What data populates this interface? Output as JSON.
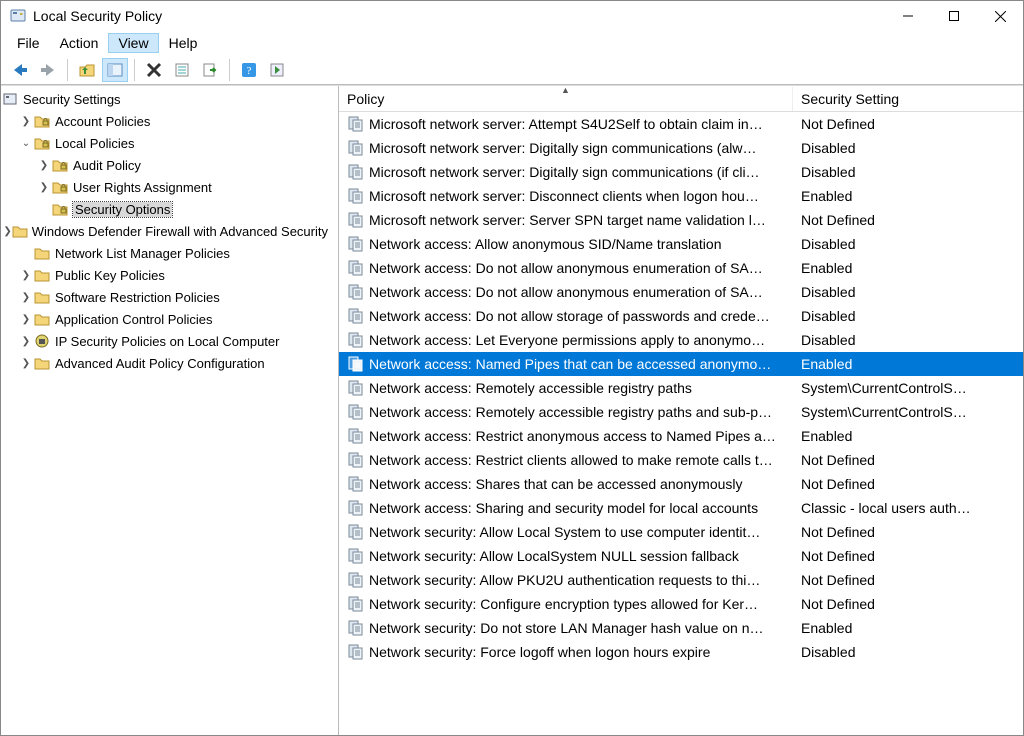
{
  "window": {
    "title": "Local Security Policy"
  },
  "menu": {
    "items": [
      "File",
      "Action",
      "View",
      "Help"
    ],
    "highlight_index": 2
  },
  "tree": {
    "root": "Security Settings",
    "nodes": [
      {
        "label": "Account Policies",
        "depth": 1,
        "expander": "›",
        "type": "folder"
      },
      {
        "label": "Local Policies",
        "depth": 1,
        "expander": "⌄",
        "type": "folder"
      },
      {
        "label": "Audit Policy",
        "depth": 2,
        "expander": "›",
        "type": "folder"
      },
      {
        "label": "User Rights Assignment",
        "depth": 2,
        "expander": "›",
        "type": "folder"
      },
      {
        "label": "Security Options",
        "depth": 2,
        "expander": "",
        "type": "folder",
        "selected": true
      },
      {
        "label": "Windows Defender Firewall with Advanced Security",
        "depth": 1,
        "expander": "›",
        "type": "folder-plain"
      },
      {
        "label": "Network List Manager Policies",
        "depth": 1,
        "expander": "",
        "type": "folder-plain"
      },
      {
        "label": "Public Key Policies",
        "depth": 1,
        "expander": "›",
        "type": "folder-plain"
      },
      {
        "label": "Software Restriction Policies",
        "depth": 1,
        "expander": "›",
        "type": "folder-plain"
      },
      {
        "label": "Application Control Policies",
        "depth": 1,
        "expander": "›",
        "type": "folder-plain"
      },
      {
        "label": "IP Security Policies on Local Computer",
        "depth": 1,
        "expander": "›",
        "type": "ip"
      },
      {
        "label": "Advanced Audit Policy Configuration",
        "depth": 1,
        "expander": "›",
        "type": "folder-plain"
      }
    ]
  },
  "list": {
    "columns": {
      "policy": "Policy",
      "setting": "Security Setting"
    },
    "rows": [
      {
        "policy": "Microsoft network server: Attempt S4U2Self to obtain claim in…",
        "setting": "Not Defined"
      },
      {
        "policy": "Microsoft network server: Digitally sign communications (alw…",
        "setting": "Disabled"
      },
      {
        "policy": "Microsoft network server: Digitally sign communications (if cli…",
        "setting": "Disabled"
      },
      {
        "policy": "Microsoft network server: Disconnect clients when logon hou…",
        "setting": "Enabled"
      },
      {
        "policy": "Microsoft network server: Server SPN target name validation l…",
        "setting": "Not Defined"
      },
      {
        "policy": "Network access: Allow anonymous SID/Name translation",
        "setting": "Disabled"
      },
      {
        "policy": "Network access: Do not allow anonymous enumeration of SA…",
        "setting": "Enabled"
      },
      {
        "policy": "Network access: Do not allow anonymous enumeration of SA…",
        "setting": "Disabled"
      },
      {
        "policy": "Network access: Do not allow storage of passwords and crede…",
        "setting": "Disabled"
      },
      {
        "policy": "Network access: Let Everyone permissions apply to anonymo…",
        "setting": "Disabled"
      },
      {
        "policy": "Network access: Named Pipes that can be accessed anonymo…",
        "setting": "Enabled",
        "selected": true
      },
      {
        "policy": "Network access: Remotely accessible registry paths",
        "setting": "System\\CurrentControlS…"
      },
      {
        "policy": "Network access: Remotely accessible registry paths and sub-p…",
        "setting": "System\\CurrentControlS…"
      },
      {
        "policy": "Network access: Restrict anonymous access to Named Pipes a…",
        "setting": "Enabled"
      },
      {
        "policy": "Network access: Restrict clients allowed to make remote calls t…",
        "setting": "Not Defined"
      },
      {
        "policy": "Network access: Shares that can be accessed anonymously",
        "setting": "Not Defined"
      },
      {
        "policy": "Network access: Sharing and security model for local accounts",
        "setting": "Classic - local users auth…"
      },
      {
        "policy": "Network security: Allow Local System to use computer identit…",
        "setting": "Not Defined"
      },
      {
        "policy": "Network security: Allow LocalSystem NULL session fallback",
        "setting": "Not Defined"
      },
      {
        "policy": "Network security: Allow PKU2U authentication requests to thi…",
        "setting": "Not Defined"
      },
      {
        "policy": "Network security: Configure encryption types allowed for Ker…",
        "setting": "Not Defined"
      },
      {
        "policy": "Network security: Do not store LAN Manager hash value on n…",
        "setting": "Enabled"
      },
      {
        "policy": "Network security: Force logoff when logon hours expire",
        "setting": "Disabled"
      }
    ]
  }
}
